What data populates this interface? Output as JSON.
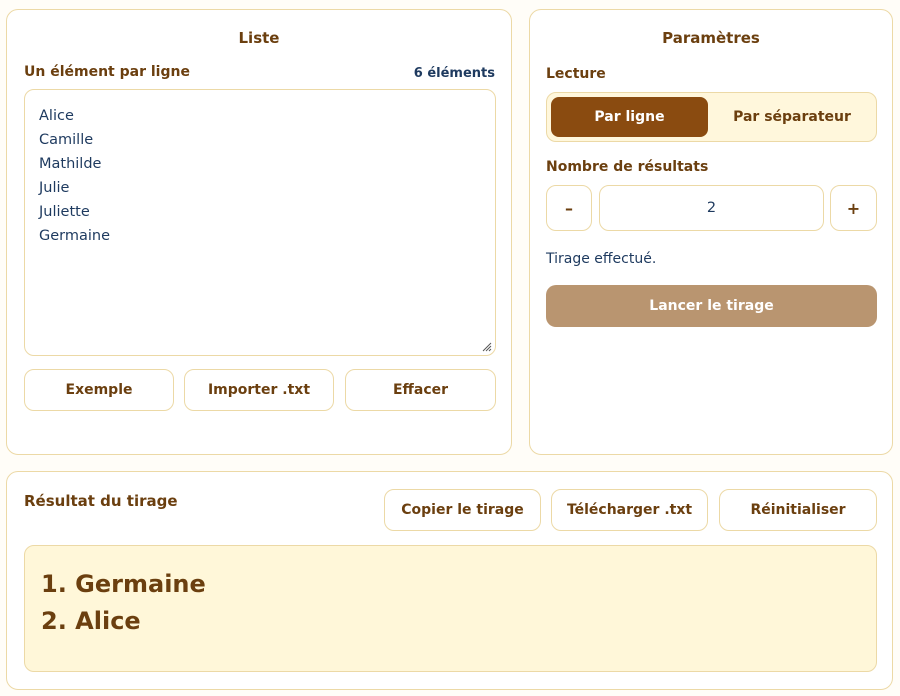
{
  "liste": {
    "title": "Liste",
    "subtitle": "Un élément par ligne",
    "count": "6 éléments",
    "items": [
      "Alice",
      "Camille",
      "Mathilde",
      "Julie",
      "Juliette",
      "Germaine"
    ],
    "buttons": {
      "example": "Exemple",
      "import": "Importer .txt",
      "clear": "Effacer"
    }
  },
  "params": {
    "title": "Paramètres",
    "reading_label": "Lecture",
    "reading_options": [
      "Par ligne",
      "Par séparateur"
    ],
    "reading_selected": "Par ligne",
    "count_label": "Nombre de résultats",
    "decrement": "–",
    "increment": "+",
    "count_value": "2",
    "status": "Tirage effectué.",
    "launch": "Lancer le tirage"
  },
  "result": {
    "title": "Résultat du tirage",
    "buttons": {
      "copy": "Copier le tirage",
      "download": "Télécharger .txt",
      "reset": "Réinitialiser"
    },
    "lines": [
      "1. Germaine",
      "2. Alice"
    ]
  },
  "colors": {
    "accent": "#8a4b10",
    "heading": "#6b3f0f",
    "text": "#1e3a5f",
    "border": "#ecd9a6",
    "launch_bg": "#b99570",
    "result_bg": "#fff7d9"
  }
}
